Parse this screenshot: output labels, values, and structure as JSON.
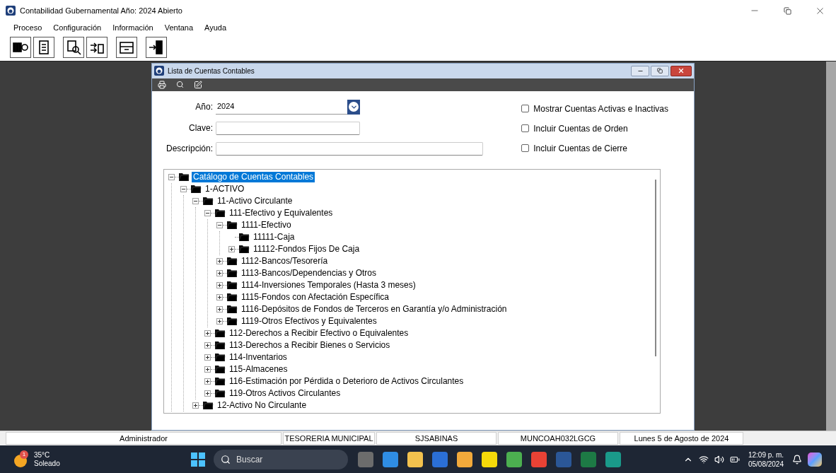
{
  "window": {
    "title": "Contabilidad Gubernamental Año: 2024 Abierto"
  },
  "menu": [
    "Proceso",
    "Configuración",
    "Información",
    "Ventana",
    "Ayuda"
  ],
  "child_window": {
    "title": "Lista de Cuentas Contables"
  },
  "form": {
    "year_label": "Año:",
    "year_value": "2024",
    "key_label": "Clave:",
    "description_label": "Descripción:"
  },
  "options": [
    {
      "label": "Mostrar Cuentas Activas e Inactivas",
      "checked": false
    },
    {
      "label": "Incluir Cuentas de Orden",
      "checked": false
    },
    {
      "label": "Incluir Cuentas de Cierre",
      "checked": false
    }
  ],
  "tree": [
    {
      "label": "Catálogo de Cuentas Contables",
      "kind": "branch",
      "expanded": true,
      "selected": true,
      "children": [
        {
          "label": "1-ACTIVO",
          "kind": "branch",
          "expanded": true,
          "selected": false,
          "children": [
            {
              "label": "11-Activo Circulante",
              "kind": "branch",
              "expanded": true,
              "selected": false,
              "children": [
                {
                  "label": "111-Efectivo y Equivalentes",
                  "kind": "branch",
                  "expanded": true,
                  "selected": false,
                  "children": [
                    {
                      "label": "1111-Efectivo",
                      "kind": "branch",
                      "expanded": true,
                      "selected": false,
                      "children": [
                        {
                          "label": "11111-Caja",
                          "kind": "leaf",
                          "selected": false
                        },
                        {
                          "label": "11112-Fondos Fijos De Caja",
                          "kind": "branch",
                          "expanded": false,
                          "selected": false
                        }
                      ]
                    },
                    {
                      "label": "1112-Bancos/Tesorería",
                      "kind": "branch",
                      "expanded": false,
                      "selected": false
                    },
                    {
                      "label": "1113-Bancos/Dependencias y Otros",
                      "kind": "branch",
                      "expanded": false,
                      "selected": false
                    },
                    {
                      "label": "1114-Inversiones Temporales (Hasta 3 meses)",
                      "kind": "branch",
                      "expanded": false,
                      "selected": false
                    },
                    {
                      "label": "1115-Fondos con Afectación Específica",
                      "kind": "branch",
                      "expanded": false,
                      "selected": false
                    },
                    {
                      "label": "1116-Depósitos de Fondos de Terceros en Garantía y/o Administración",
                      "kind": "branch",
                      "expanded": false,
                      "selected": false
                    },
                    {
                      "label": "1119-Otros Efectivos y Equivalentes",
                      "kind": "branch",
                      "expanded": false,
                      "selected": false
                    }
                  ]
                },
                {
                  "label": "112-Derechos a Recibir Efectivo o Equivalentes",
                  "kind": "branch",
                  "expanded": false,
                  "selected": false
                },
                {
                  "label": "113-Derechos a Recibir Bienes o Servicios",
                  "kind": "branch",
                  "expanded": false,
                  "selected": false
                },
                {
                  "label": "114-Inventarios",
                  "kind": "branch",
                  "expanded": false,
                  "selected": false
                },
                {
                  "label": "115-Almacenes",
                  "kind": "branch",
                  "expanded": false,
                  "selected": false
                },
                {
                  "label": "116-Estimación por Pérdida o Deterioro de Activos Circulantes",
                  "kind": "branch",
                  "expanded": false,
                  "selected": false
                },
                {
                  "label": "119-Otros Activos Circulantes",
                  "kind": "branch",
                  "expanded": false,
                  "selected": false
                }
              ]
            },
            {
              "label": "12-Activo No Circulante",
              "kind": "branch",
              "expanded": false,
              "selected": false
            }
          ]
        }
      ]
    }
  ],
  "status_bar": [
    "Administrador",
    "TESORERIA MUNICIPAL",
    "SJSABINAS",
    "MUNCOAH032LGCG",
    "Lunes 5 de Agosto de 2024"
  ],
  "taskbar": {
    "weather_badge": "1",
    "temperature": "35°C",
    "condition": "Soleado",
    "search_placeholder": "Buscar",
    "time": "12:09 p. m.",
    "date": "05/08/2024"
  }
}
